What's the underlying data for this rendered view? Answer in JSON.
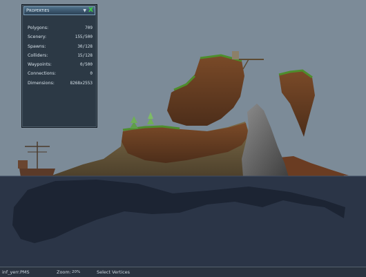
{
  "properties_panel": {
    "title": "Properties",
    "collapse_icon": "chevron-down-icon",
    "close_label": "X",
    "rows": [
      {
        "label": "Polygons:",
        "value": "709"
      },
      {
        "label": "Scenery:",
        "value": "155/500"
      },
      {
        "label": "Spawns:",
        "value": "30/128"
      },
      {
        "label": "Colliders:",
        "value": "15/128"
      },
      {
        "label": "Waypoints:",
        "value": "0/500"
      },
      {
        "label": "Connections:",
        "value": "0"
      },
      {
        "label": "Dimensions:",
        "value": "8268x2553"
      }
    ]
  },
  "statusbar": {
    "file": "inf_yerr.PMS",
    "zoom_label": "Zoom:",
    "zoom_value": "20%",
    "mode": "Select Vertices"
  },
  "colors": {
    "sky": "#7c8b98",
    "water": "#2b3547",
    "grass": "#4a8a2e",
    "dirt": "#6b3f22",
    "rock": "#7a7a7a",
    "panel_bg": "#2c3945",
    "close_accent": "#3bd33b"
  }
}
